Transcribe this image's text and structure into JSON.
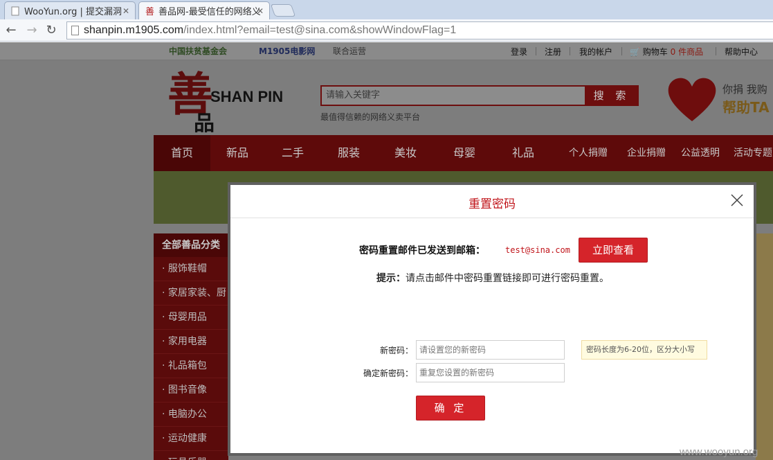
{
  "browser": {
    "tabs": [
      {
        "label": "WooYun.org | 提交漏洞",
        "active": false
      },
      {
        "label": "善品网-最受信任的网络义",
        "active": true
      }
    ],
    "url_host": "shanpin.m1905.com",
    "url_rest": "/index.html?email=test@sina.com&showWindowFlag=1"
  },
  "topbar": {
    "partner1": "中国扶贫基金会",
    "partner2": "M1905电影网",
    "partner3": "联合运营",
    "login": "登录",
    "register": "注册",
    "account": "我的帐户",
    "cart_label": "购物车",
    "cart_count": "0",
    "cart_unit": "件商品",
    "help": "帮助中心"
  },
  "header": {
    "logo_char": "善",
    "logo_text": "SHAN PIN",
    "logo_sub": "品",
    "search_placeholder": "请输入关键字",
    "search_button": "搜 索",
    "slogan": "最值得信赖的网络义卖平台",
    "donate_line1": "你捐 我购",
    "donate_line2": "帮助TA"
  },
  "nav": {
    "items": [
      "首页",
      "新品",
      "二手",
      "服装",
      "美妆",
      "母婴",
      "礼品"
    ],
    "links": [
      "个人捐赠",
      "企业捐赠",
      "公益透明",
      "活动专题"
    ]
  },
  "sidebar": {
    "title": "全部善品分类",
    "categories": [
      "· 服饰鞋帽",
      "· 家居家装、厨",
      "· 母婴用品",
      "· 家用电器",
      "· 礼品箱包",
      "· 图书音像",
      "· 电脑办公",
      "· 运动健康",
      "· 玩具乐器"
    ]
  },
  "modal": {
    "title": "重置密码",
    "sent_text": "密码重置邮件已发送到邮箱：",
    "email": "test@sina.com",
    "check_button": "立即查看",
    "hint_label": "提示：",
    "hint_text": "请点击邮件中密码重置链接即可进行密码重置。",
    "new_pw_label": "新密码：",
    "new_pw_placeholder": "请设置您的新密码",
    "confirm_pw_label": "确定新密码：",
    "confirm_pw_placeholder": "重复您设置的新密码",
    "tip": "密码长度为6-20位，区分大小写",
    "submit_button": "确 定"
  },
  "watermark": "www.wooyun.org",
  "colors": {
    "accent": "#d5242a",
    "nav": "#5e0a0a",
    "title": "#c0141a"
  }
}
